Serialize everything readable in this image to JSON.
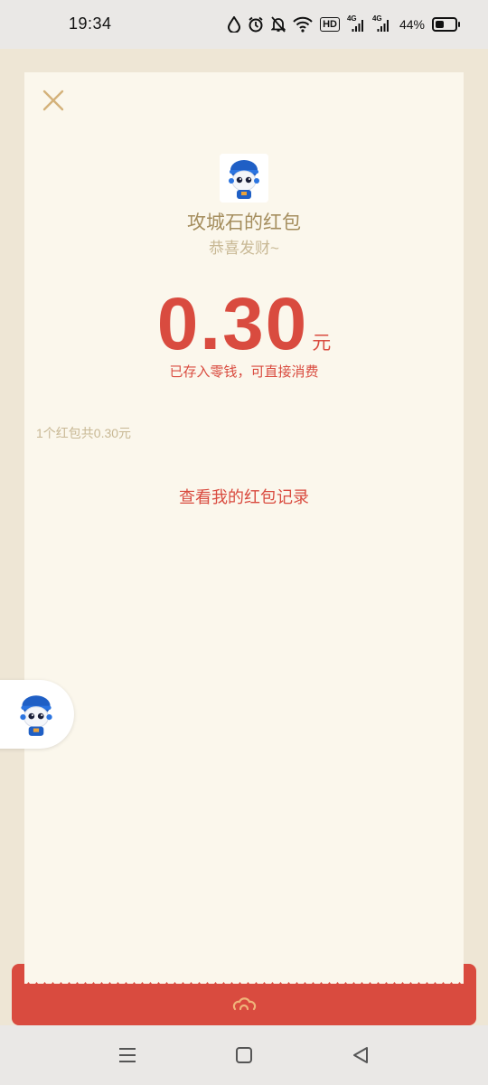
{
  "status_bar": {
    "time": "19:34",
    "network_badge": "HD",
    "signal_1": "4G",
    "signal_2": "4G",
    "battery_percent": "44%",
    "icons": [
      "water-drop-icon",
      "alarm-icon",
      "bell-muted-icon",
      "wifi-icon",
      "hd-icon",
      "signal-4g-icon",
      "signal-4g-icon",
      "battery-icon"
    ]
  },
  "red_packet": {
    "sender_name": "攻城石的红包",
    "greeting": "恭喜发财~",
    "amount": "0.30",
    "unit": "元",
    "saved_note": "已存入零钱，可直接消费",
    "summary": "1个红包共0.30元",
    "records_link": "查看我的红包记录"
  },
  "colors": {
    "accent_red": "#d94b3f",
    "gold_text": "#a58e5e",
    "muted_gold": "#c8b894",
    "card_bg": "#fbf7ec",
    "page_bg": "#eee6d5"
  },
  "navigation": {
    "icons": [
      "menu-icon",
      "home-square-icon",
      "back-triangle-icon"
    ]
  }
}
